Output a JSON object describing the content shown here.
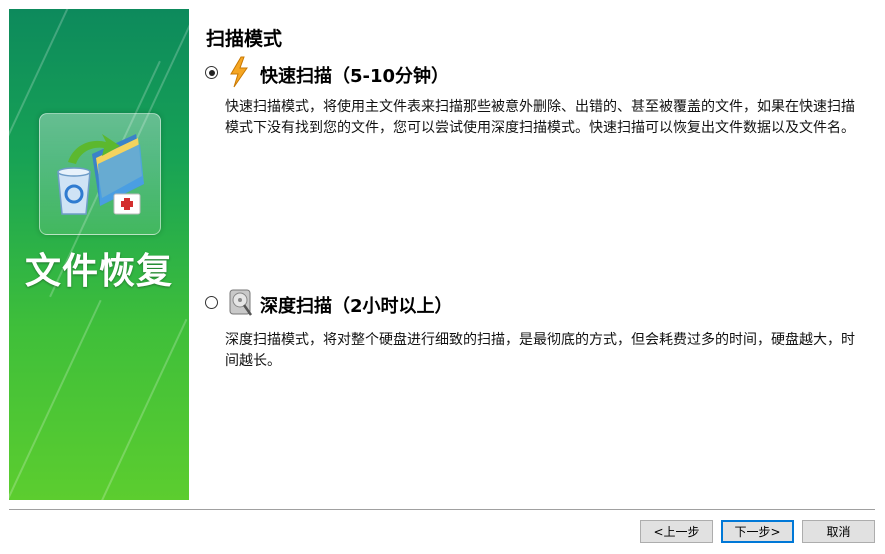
{
  "sidebar": {
    "title": "文件恢复",
    "icon": "recycle-bin-folder-recovery-icon"
  },
  "section_title": "扫描模式",
  "options": [
    {
      "title": "快速扫描（5-10分钟）",
      "selected": true,
      "icon": "lightning-icon",
      "description": "快速扫描模式，将使用主文件表来扫描那些被意外删除、出错的、甚至被覆盖的文件，如果在快速扫描模式下没有找到您的文件，您可以尝试使用深度扫描模式。快速扫描可以恢复出文件数据以及文件名。"
    },
    {
      "title": "深度扫描（2小时以上）",
      "selected": false,
      "icon": "hard-disk-search-icon",
      "description": "深度扫描模式，将对整个硬盘进行细致的扫描，是最彻底的方式，但会耗费过多的时间，硬盘越大，时间越长。"
    }
  ],
  "buttons": {
    "back": "<上一步",
    "next": "下一步>",
    "cancel": "取消"
  }
}
